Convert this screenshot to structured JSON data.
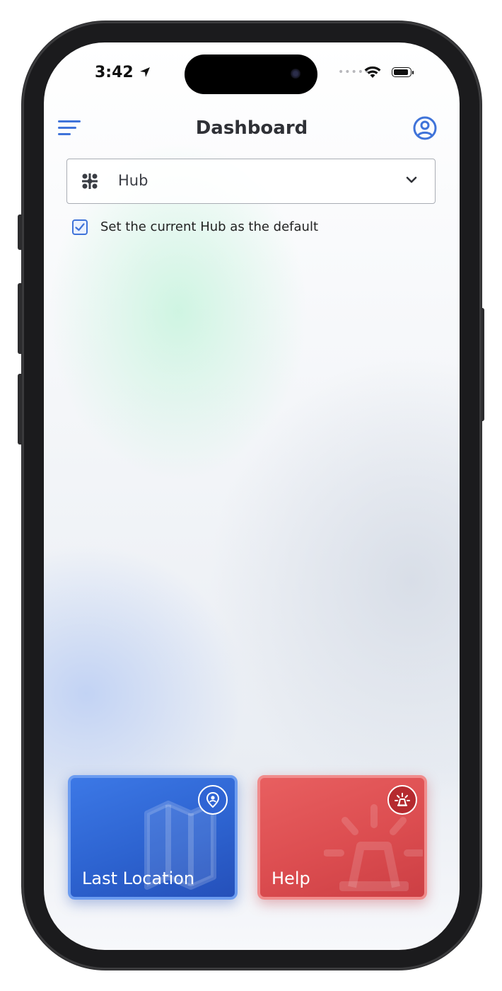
{
  "status_bar": {
    "time": "3:42",
    "battery_level": 0.9
  },
  "header": {
    "title": "Dashboard",
    "menu_icon": "hamburger-menu-icon",
    "profile_icon": "user-circle-icon"
  },
  "hub_select": {
    "icon": "hub-network-icon",
    "value": "Hub",
    "chevron_icon": "chevron-down-icon"
  },
  "default_option": {
    "checked": true,
    "label": "Set the current Hub as the default"
  },
  "tiles": [
    {
      "label": "Last Location",
      "icon": "location-pin-icon",
      "color": "#2f64d4"
    },
    {
      "label": "Help",
      "icon": "siren-alarm-icon",
      "color": "#dc4d50"
    }
  ],
  "colors": {
    "accent": "#3f73d9",
    "title_text": "#2f3136"
  }
}
